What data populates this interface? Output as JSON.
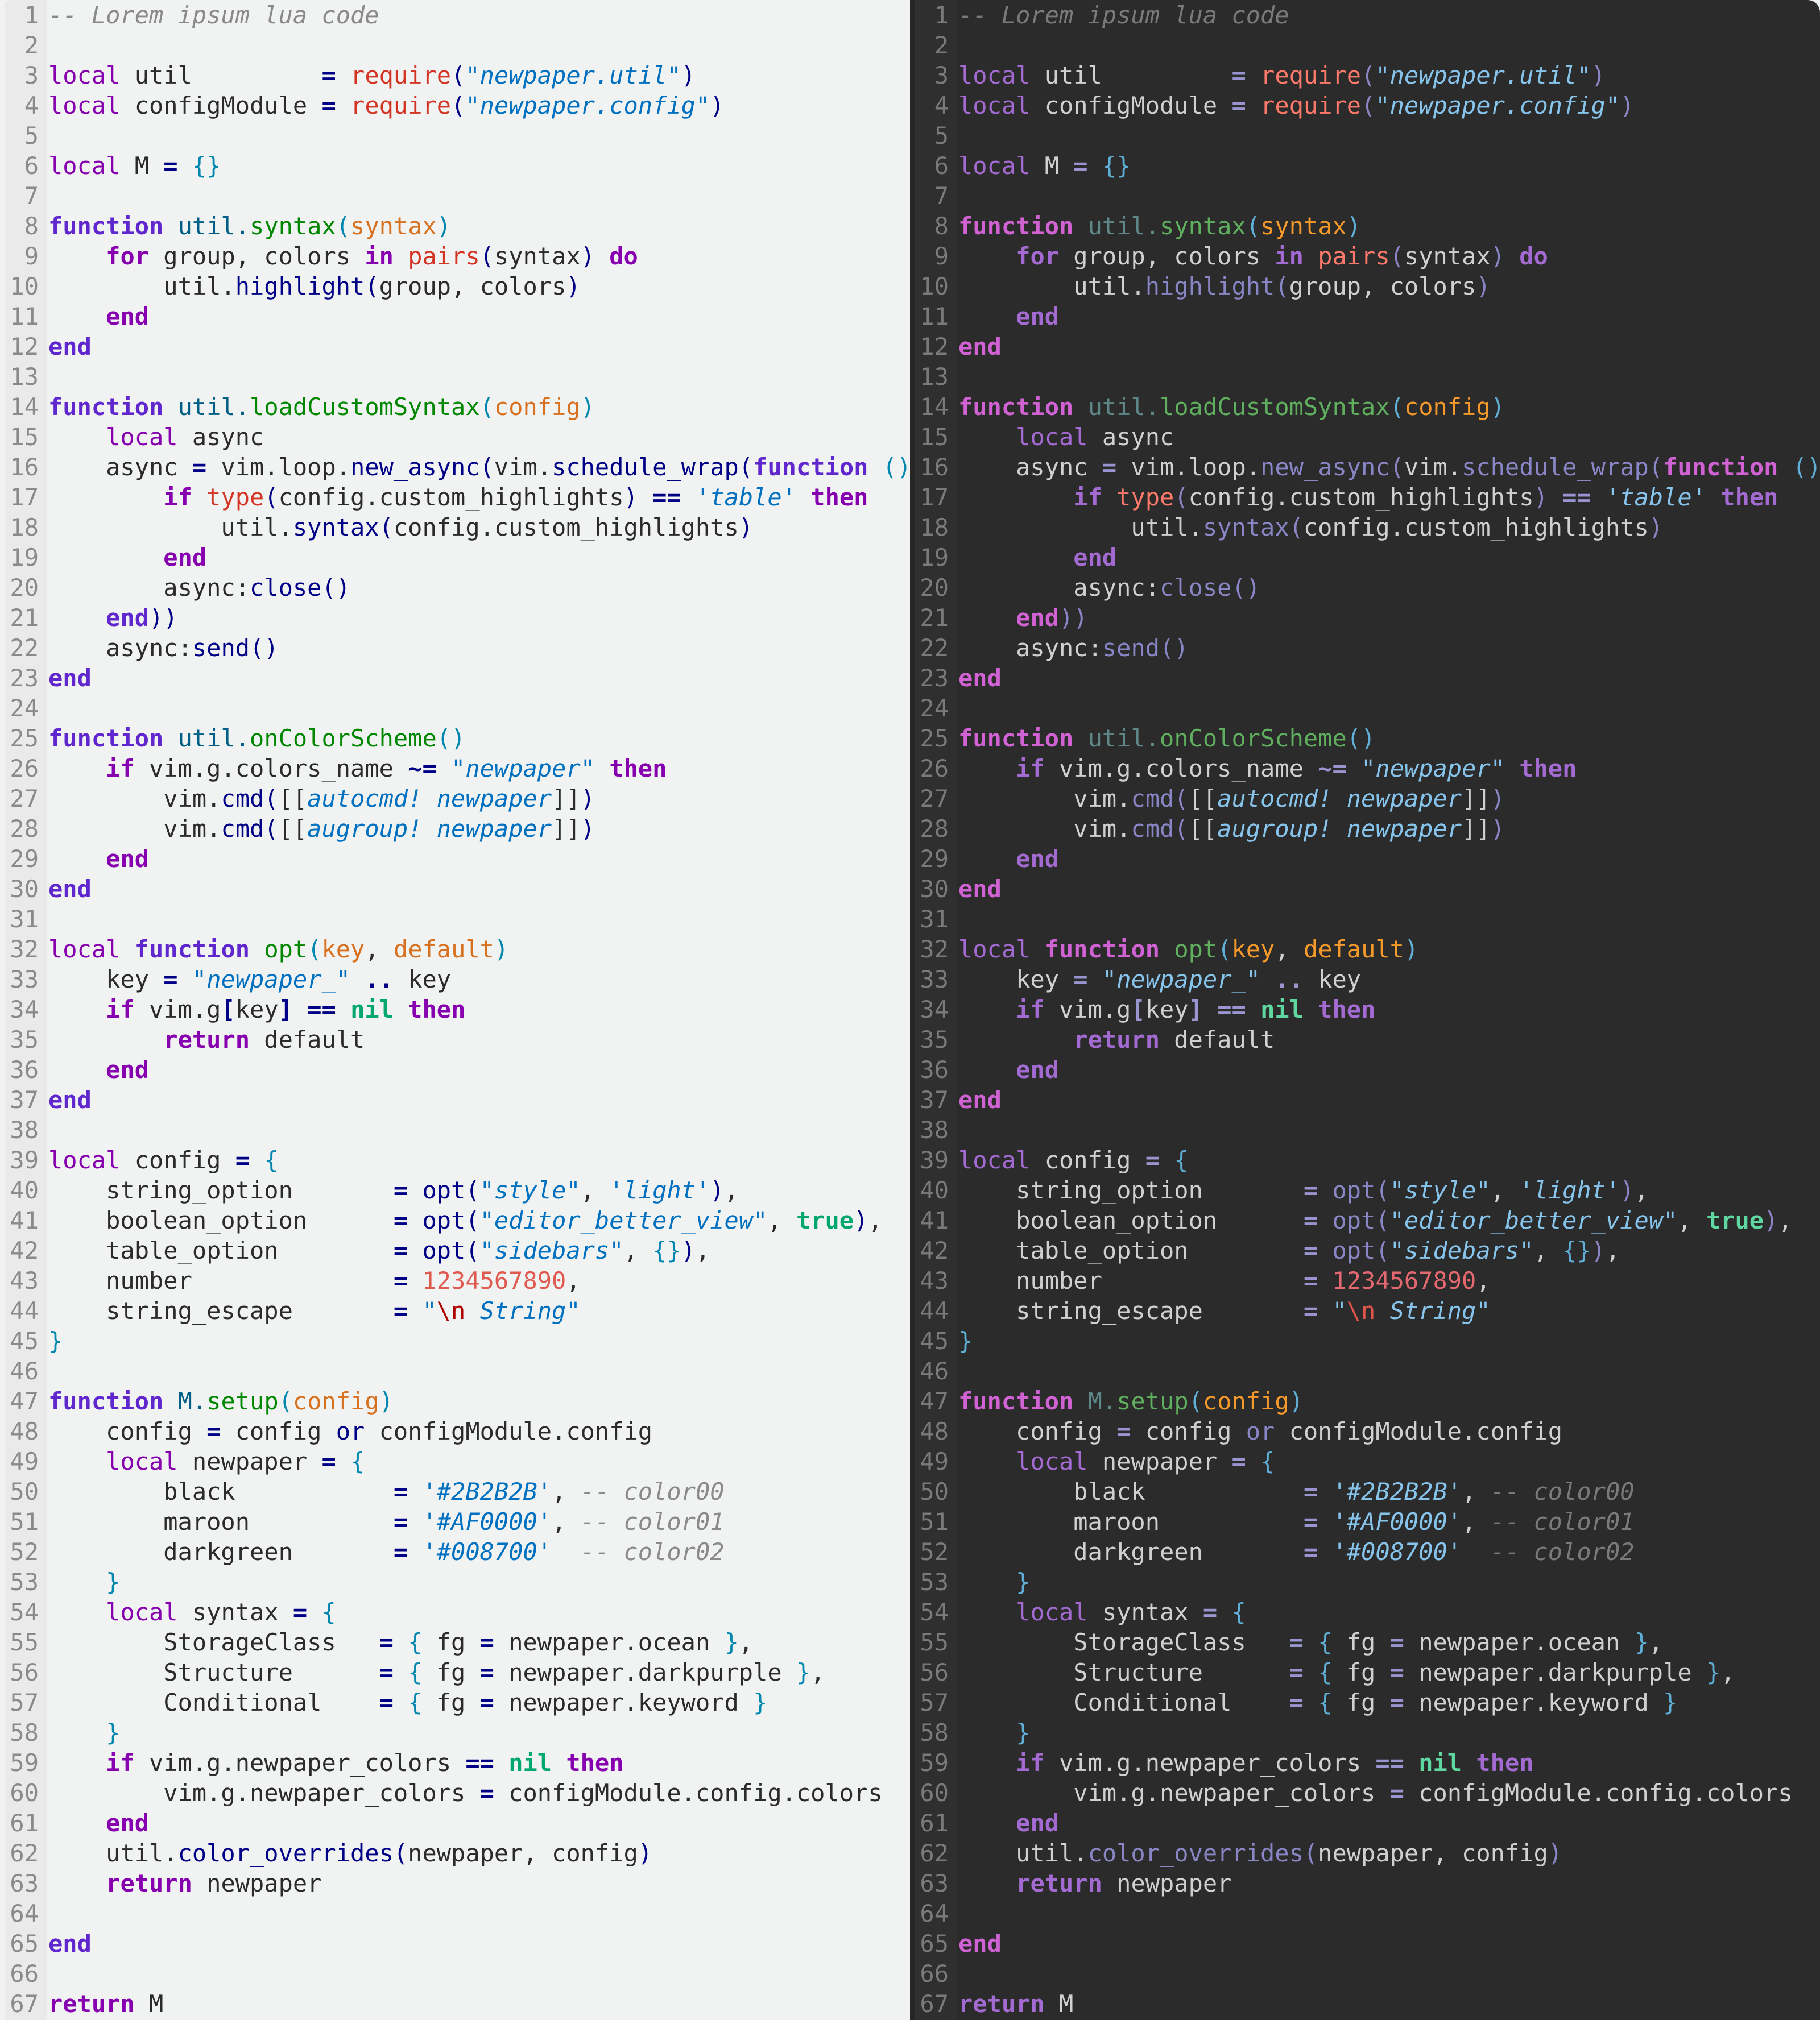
{
  "editor": {
    "language_comment": "Lorem ipsum lua code",
    "themes": [
      {
        "name": "light",
        "background": "#F1F2F2"
      },
      {
        "name": "dark",
        "background": "#2B2B2B"
      }
    ],
    "lines": [
      [
        [
          "cm",
          "-- Lorem ipsum lua code"
        ]
      ],
      [],
      [
        [
          "kw",
          "local"
        ],
        [
          "id",
          " util         "
        ],
        [
          "op",
          "="
        ],
        [
          "id",
          " "
        ],
        [
          "bi",
          "require"
        ],
        [
          "pn",
          "("
        ],
        [
          "qt",
          "\""
        ],
        [
          "str",
          "newpaper.util"
        ],
        [
          "qt",
          "\""
        ],
        [
          "pn",
          ")"
        ]
      ],
      [
        [
          "kw",
          "local"
        ],
        [
          "id",
          " configModule "
        ],
        [
          "op",
          "="
        ],
        [
          "id",
          " "
        ],
        [
          "bi",
          "require"
        ],
        [
          "pn",
          "("
        ],
        [
          "qt",
          "\""
        ],
        [
          "str",
          "newpaper.config"
        ],
        [
          "qt",
          "\""
        ],
        [
          "pn",
          ")"
        ]
      ],
      [],
      [
        [
          "kw",
          "local"
        ],
        [
          "id",
          " M "
        ],
        [
          "op",
          "="
        ],
        [
          "id",
          " "
        ],
        [
          "br",
          "{}"
        ]
      ],
      [],
      [
        [
          "fn",
          "function"
        ],
        [
          "id",
          " "
        ],
        [
          "mod",
          "util."
        ],
        [
          "fname",
          "syntax"
        ],
        [
          "br",
          "("
        ],
        [
          "param",
          "syntax"
        ],
        [
          "br",
          ")"
        ]
      ],
      [
        [
          "id",
          "    "
        ],
        [
          "kwb",
          "for"
        ],
        [
          "id",
          " group, colors "
        ],
        [
          "kwb",
          "in"
        ],
        [
          "id",
          " "
        ],
        [
          "bi",
          "pairs"
        ],
        [
          "pn",
          "("
        ],
        [
          "id",
          "syntax"
        ],
        [
          "pn",
          ")"
        ],
        [
          "id",
          " "
        ],
        [
          "kwb",
          "do"
        ]
      ],
      [
        [
          "id",
          "        util."
        ],
        [
          "call",
          "highlight"
        ],
        [
          "pn",
          "("
        ],
        [
          "id",
          "group, colors"
        ],
        [
          "pn",
          ")"
        ]
      ],
      [
        [
          "id",
          "    "
        ],
        [
          "kwb",
          "end"
        ]
      ],
      [
        [
          "fn",
          "end"
        ]
      ],
      [],
      [
        [
          "fn",
          "function"
        ],
        [
          "id",
          " "
        ],
        [
          "mod",
          "util."
        ],
        [
          "fname",
          "loadCustomSyntax"
        ],
        [
          "br",
          "("
        ],
        [
          "param",
          "config"
        ],
        [
          "br",
          ")"
        ]
      ],
      [
        [
          "id",
          "    "
        ],
        [
          "kw",
          "local"
        ],
        [
          "id",
          " async"
        ]
      ],
      [
        [
          "id",
          "    async "
        ],
        [
          "op",
          "="
        ],
        [
          "id",
          " vim.loop."
        ],
        [
          "call",
          "new_async"
        ],
        [
          "pn",
          "("
        ],
        [
          "id",
          "vim."
        ],
        [
          "call",
          "schedule_wrap"
        ],
        [
          "pn",
          "("
        ],
        [
          "fn",
          "function"
        ],
        [
          "id",
          " "
        ],
        [
          "br",
          "()"
        ]
      ],
      [
        [
          "id",
          "        "
        ],
        [
          "kwb",
          "if"
        ],
        [
          "id",
          " "
        ],
        [
          "bi",
          "type"
        ],
        [
          "pn",
          "("
        ],
        [
          "id",
          "config.custom_highlights"
        ],
        [
          "pn",
          ")"
        ],
        [
          "id",
          " "
        ],
        [
          "op",
          "=="
        ],
        [
          "id",
          " "
        ],
        [
          "qt",
          "'"
        ],
        [
          "str",
          "table"
        ],
        [
          "qt",
          "'"
        ],
        [
          "id",
          " "
        ],
        [
          "kwb",
          "then"
        ]
      ],
      [
        [
          "id",
          "            util."
        ],
        [
          "call",
          "syntax"
        ],
        [
          "pn",
          "("
        ],
        [
          "id",
          "config.custom_highlights"
        ],
        [
          "pn",
          ")"
        ]
      ],
      [
        [
          "id",
          "        "
        ],
        [
          "kwb",
          "end"
        ]
      ],
      [
        [
          "id",
          "        async:"
        ],
        [
          "call",
          "close"
        ],
        [
          "pn",
          "()"
        ]
      ],
      [
        [
          "id",
          "    "
        ],
        [
          "fn",
          "end"
        ],
        [
          "pn",
          "))"
        ]
      ],
      [
        [
          "id",
          "    async:"
        ],
        [
          "call",
          "send"
        ],
        [
          "pn",
          "()"
        ]
      ],
      [
        [
          "fn",
          "end"
        ]
      ],
      [],
      [
        [
          "fn",
          "function"
        ],
        [
          "id",
          " "
        ],
        [
          "mod",
          "util."
        ],
        [
          "fname",
          "onColorScheme"
        ],
        [
          "br",
          "()"
        ]
      ],
      [
        [
          "id",
          "    "
        ],
        [
          "kwb",
          "if"
        ],
        [
          "id",
          " vim.g.colors_name "
        ],
        [
          "op",
          "~="
        ],
        [
          "id",
          " "
        ],
        [
          "qt",
          "\""
        ],
        [
          "str",
          "newpaper"
        ],
        [
          "qt",
          "\""
        ],
        [
          "id",
          " "
        ],
        [
          "kwb",
          "then"
        ]
      ],
      [
        [
          "id",
          "        vim."
        ],
        [
          "call",
          "cmd"
        ],
        [
          "pn",
          "("
        ],
        [
          "id",
          "[["
        ],
        [
          "str",
          "autocmd! newpaper"
        ],
        [
          "id",
          "]]"
        ],
        [
          "pn",
          ")"
        ]
      ],
      [
        [
          "id",
          "        vim."
        ],
        [
          "call",
          "cmd"
        ],
        [
          "pn",
          "("
        ],
        [
          "id",
          "[["
        ],
        [
          "str",
          "augroup! newpaper"
        ],
        [
          "id",
          "]]"
        ],
        [
          "pn",
          ")"
        ]
      ],
      [
        [
          "id",
          "    "
        ],
        [
          "kwb",
          "end"
        ]
      ],
      [
        [
          "fn",
          "end"
        ]
      ],
      [],
      [
        [
          "kw",
          "local"
        ],
        [
          "id",
          " "
        ],
        [
          "fn",
          "function"
        ],
        [
          "id",
          " "
        ],
        [
          "fname",
          "opt"
        ],
        [
          "br",
          "("
        ],
        [
          "param",
          "key"
        ],
        [
          "id",
          ", "
        ],
        [
          "param",
          "default"
        ],
        [
          "br",
          ")"
        ]
      ],
      [
        [
          "id",
          "    key "
        ],
        [
          "op",
          "="
        ],
        [
          "id",
          " "
        ],
        [
          "qt",
          "\""
        ],
        [
          "str",
          "newpaper_"
        ],
        [
          "qt",
          "\""
        ],
        [
          "id",
          " "
        ],
        [
          "op",
          ".."
        ],
        [
          "id",
          " key"
        ]
      ],
      [
        [
          "id",
          "    "
        ],
        [
          "kwb",
          "if"
        ],
        [
          "id",
          " vim.g"
        ],
        [
          "op",
          "["
        ],
        [
          "id",
          "key"
        ],
        [
          "op",
          "]"
        ],
        [
          "id",
          " "
        ],
        [
          "op",
          "=="
        ],
        [
          "id",
          " "
        ],
        [
          "bool",
          "nil"
        ],
        [
          "id",
          " "
        ],
        [
          "kwb",
          "then"
        ]
      ],
      [
        [
          "id",
          "        "
        ],
        [
          "kwb",
          "return"
        ],
        [
          "id",
          " default"
        ]
      ],
      [
        [
          "id",
          "    "
        ],
        [
          "kwb",
          "end"
        ]
      ],
      [
        [
          "fn",
          "end"
        ]
      ],
      [],
      [
        [
          "kw",
          "local"
        ],
        [
          "id",
          " config "
        ],
        [
          "op",
          "="
        ],
        [
          "id",
          " "
        ],
        [
          "br",
          "{"
        ]
      ],
      [
        [
          "id",
          "    string_option       "
        ],
        [
          "op",
          "="
        ],
        [
          "id",
          " "
        ],
        [
          "call",
          "opt"
        ],
        [
          "pn",
          "("
        ],
        [
          "qt",
          "\""
        ],
        [
          "str",
          "style"
        ],
        [
          "qt",
          "\""
        ],
        [
          "id",
          ", "
        ],
        [
          "qt",
          "'"
        ],
        [
          "str",
          "light"
        ],
        [
          "qt",
          "'"
        ],
        [
          "pn",
          ")"
        ],
        [
          "id",
          ","
        ]
      ],
      [
        [
          "id",
          "    boolean_option      "
        ],
        [
          "op",
          "="
        ],
        [
          "id",
          " "
        ],
        [
          "call",
          "opt"
        ],
        [
          "pn",
          "("
        ],
        [
          "qt",
          "\""
        ],
        [
          "str",
          "editor_better_view"
        ],
        [
          "qt",
          "\""
        ],
        [
          "id",
          ", "
        ],
        [
          "bool",
          "true"
        ],
        [
          "pn",
          ")"
        ],
        [
          "id",
          ","
        ]
      ],
      [
        [
          "id",
          "    table_option        "
        ],
        [
          "op",
          "="
        ],
        [
          "id",
          " "
        ],
        [
          "call",
          "opt"
        ],
        [
          "pn",
          "("
        ],
        [
          "qt",
          "\""
        ],
        [
          "str",
          "sidebars"
        ],
        [
          "qt",
          "\""
        ],
        [
          "id",
          ", "
        ],
        [
          "br",
          "{}"
        ],
        [
          "pn",
          ")"
        ],
        [
          "id",
          ","
        ]
      ],
      [
        [
          "id",
          "    number              "
        ],
        [
          "op",
          "="
        ],
        [
          "id",
          " "
        ],
        [
          "num",
          "1234567890"
        ],
        [
          "id",
          ","
        ]
      ],
      [
        [
          "id",
          "    string_escape       "
        ],
        [
          "op",
          "="
        ],
        [
          "id",
          " "
        ],
        [
          "qt",
          "\""
        ],
        [
          "esc",
          "\\n"
        ],
        [
          "str",
          " String"
        ],
        [
          "qt",
          "\""
        ]
      ],
      [
        [
          "br",
          "}"
        ]
      ],
      [],
      [
        [
          "fn",
          "function"
        ],
        [
          "id",
          " "
        ],
        [
          "mod",
          "M."
        ],
        [
          "fname",
          "setup"
        ],
        [
          "br",
          "("
        ],
        [
          "param",
          "config"
        ],
        [
          "br",
          ")"
        ]
      ],
      [
        [
          "id",
          "    config "
        ],
        [
          "op",
          "="
        ],
        [
          "id",
          " config "
        ],
        [
          "call",
          "or"
        ],
        [
          "id",
          " configModule.config"
        ]
      ],
      [
        [
          "id",
          "    "
        ],
        [
          "kw",
          "local"
        ],
        [
          "id",
          " newpaper "
        ],
        [
          "op",
          "="
        ],
        [
          "id",
          " "
        ],
        [
          "br",
          "{"
        ]
      ],
      [
        [
          "id",
          "        black           "
        ],
        [
          "op",
          "="
        ],
        [
          "id",
          " "
        ],
        [
          "qt",
          "'"
        ],
        [
          "str",
          "#2B2B2B"
        ],
        [
          "qt",
          "'"
        ],
        [
          "id",
          ", "
        ],
        [
          "cm",
          "-- color00"
        ]
      ],
      [
        [
          "id",
          "        maroon          "
        ],
        [
          "op",
          "="
        ],
        [
          "id",
          " "
        ],
        [
          "qt",
          "'"
        ],
        [
          "str",
          "#AF0000"
        ],
        [
          "qt",
          "'"
        ],
        [
          "id",
          ", "
        ],
        [
          "cm",
          "-- color01"
        ]
      ],
      [
        [
          "id",
          "        darkgreen       "
        ],
        [
          "op",
          "="
        ],
        [
          "id",
          " "
        ],
        [
          "qt",
          "'"
        ],
        [
          "str",
          "#008700"
        ],
        [
          "qt",
          "'"
        ],
        [
          "id",
          "  "
        ],
        [
          "cm",
          "-- color02"
        ]
      ],
      [
        [
          "id",
          "    "
        ],
        [
          "br",
          "}"
        ]
      ],
      [
        [
          "id",
          "    "
        ],
        [
          "kw",
          "local"
        ],
        [
          "id",
          " syntax "
        ],
        [
          "op",
          "="
        ],
        [
          "id",
          " "
        ],
        [
          "br",
          "{"
        ]
      ],
      [
        [
          "id",
          "        StorageClass   "
        ],
        [
          "op",
          "="
        ],
        [
          "id",
          " "
        ],
        [
          "br",
          "{"
        ],
        [
          "id",
          " fg "
        ],
        [
          "op",
          "="
        ],
        [
          "id",
          " newpaper.ocean "
        ],
        [
          "br",
          "}"
        ],
        [
          "id",
          ","
        ]
      ],
      [
        [
          "id",
          "        Structure      "
        ],
        [
          "op",
          "="
        ],
        [
          "id",
          " "
        ],
        [
          "br",
          "{"
        ],
        [
          "id",
          " fg "
        ],
        [
          "op",
          "="
        ],
        [
          "id",
          " newpaper.darkpurple "
        ],
        [
          "br",
          "}"
        ],
        [
          "id",
          ","
        ]
      ],
      [
        [
          "id",
          "        Conditional    "
        ],
        [
          "op",
          "="
        ],
        [
          "id",
          " "
        ],
        [
          "br",
          "{"
        ],
        [
          "id",
          " fg "
        ],
        [
          "op",
          "="
        ],
        [
          "id",
          " newpaper.keyword "
        ],
        [
          "br",
          "}"
        ]
      ],
      [
        [
          "id",
          "    "
        ],
        [
          "br",
          "}"
        ]
      ],
      [
        [
          "id",
          "    "
        ],
        [
          "kwb",
          "if"
        ],
        [
          "id",
          " vim.g.newpaper_colors "
        ],
        [
          "op",
          "=="
        ],
        [
          "id",
          " "
        ],
        [
          "bool",
          "nil"
        ],
        [
          "id",
          " "
        ],
        [
          "kwb",
          "then"
        ]
      ],
      [
        [
          "id",
          "        vim.g.newpaper_colors "
        ],
        [
          "op",
          "="
        ],
        [
          "id",
          " configModule.config.colors"
        ]
      ],
      [
        [
          "id",
          "    "
        ],
        [
          "kwb",
          "end"
        ]
      ],
      [
        [
          "id",
          "    util."
        ],
        [
          "call",
          "color_overrides"
        ],
        [
          "pn",
          "("
        ],
        [
          "id",
          "newpaper, config"
        ],
        [
          "pn",
          ")"
        ]
      ],
      [
        [
          "id",
          "    "
        ],
        [
          "kwb",
          "return"
        ],
        [
          "id",
          " newpaper"
        ]
      ],
      [],
      [
        [
          "fn",
          "end"
        ]
      ],
      [],
      [
        [
          "kwb",
          "return"
        ],
        [
          "id",
          " M"
        ]
      ]
    ]
  }
}
